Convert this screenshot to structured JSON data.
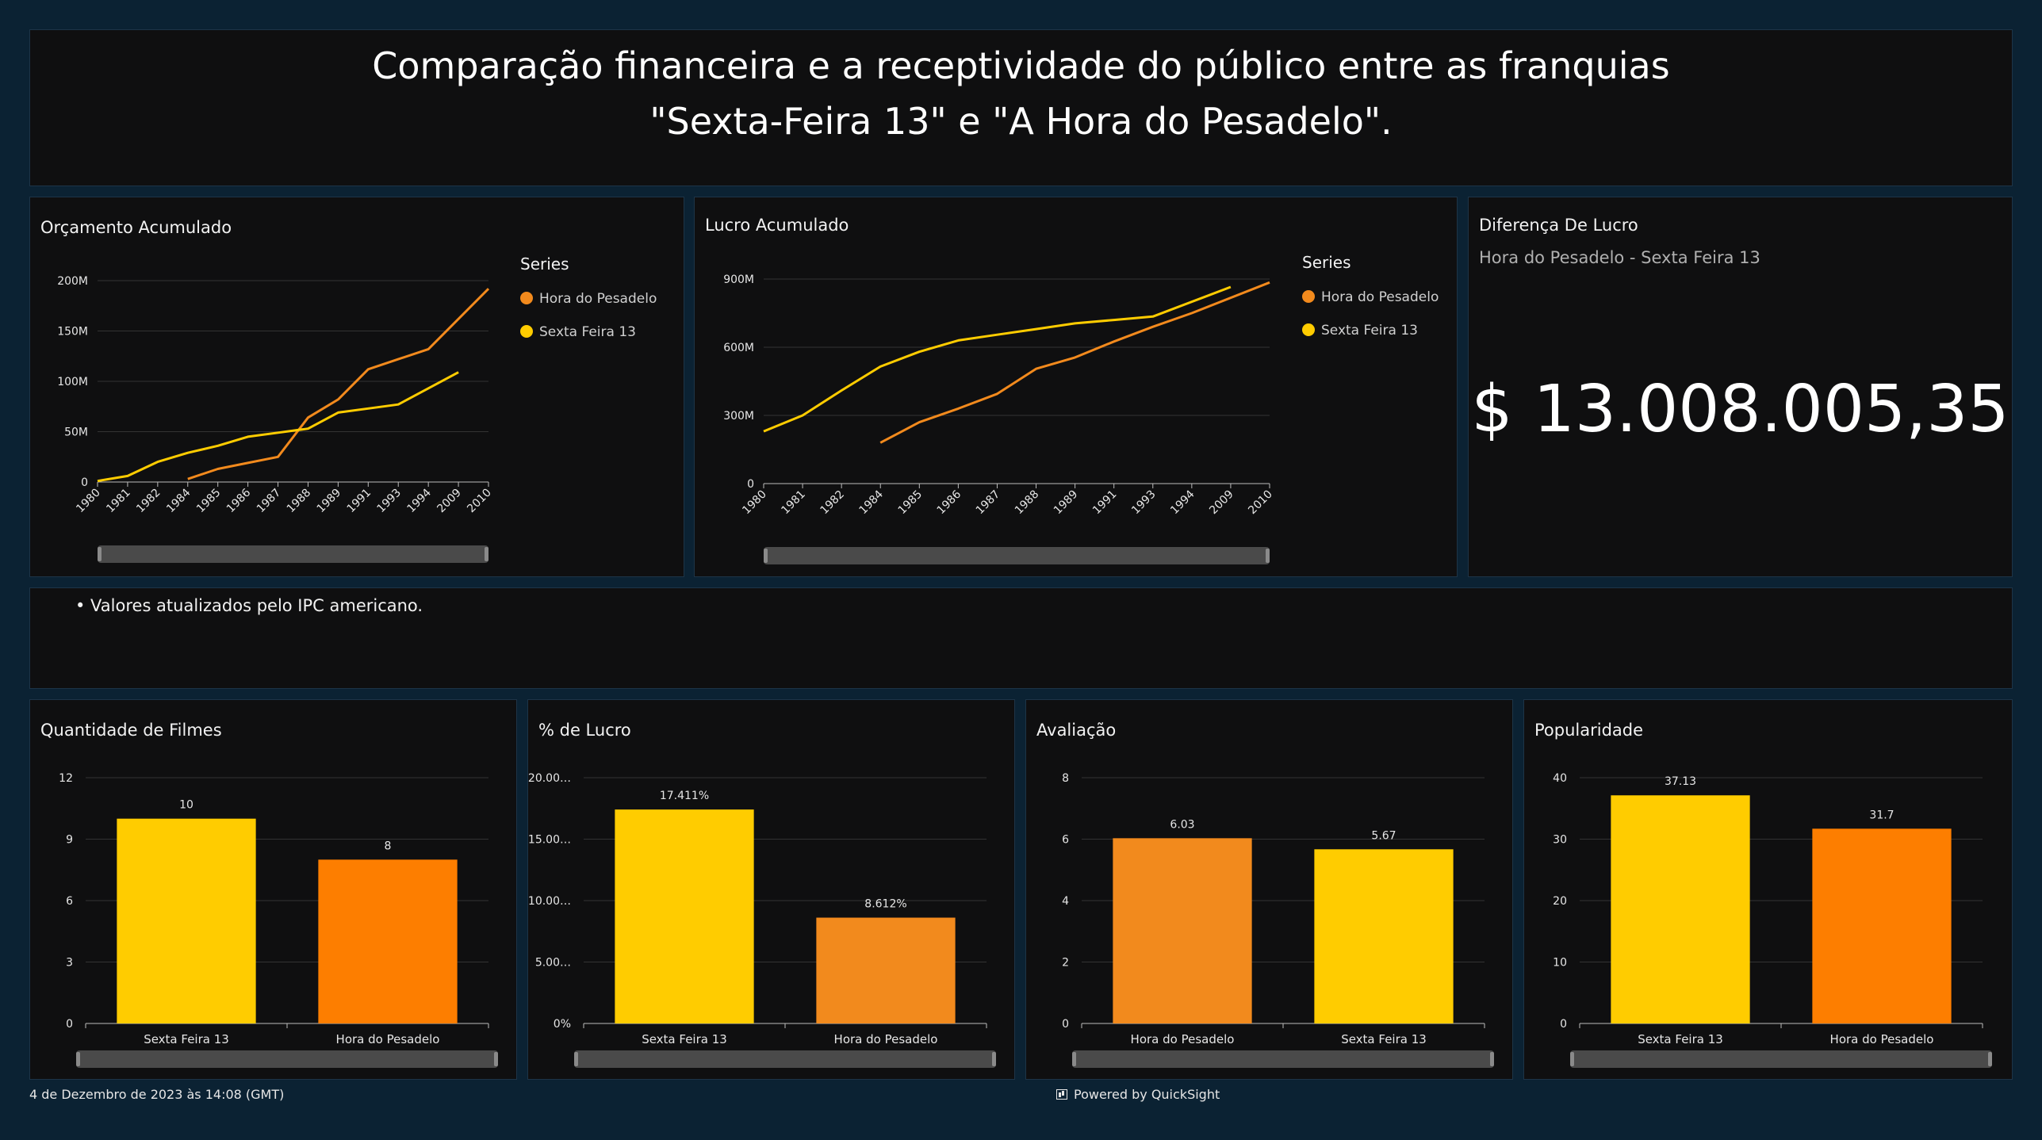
{
  "header": {
    "title_line1": "Comparação financeira e a receptividade do público entre as franquias",
    "title_line2": "\"Sexta-Feira 13\" e \"A Hora do Pesadelo\"."
  },
  "colors": {
    "hora": "#f28a1d",
    "sexta": "#ffcc00",
    "panel_bg": "#0f0f10",
    "page_bg": "#0b2233"
  },
  "kpi": {
    "title": "Diferença De Lucro",
    "subtitle": "Hora do Pesadelo - Sexta Feira 13",
    "value": "$ 13.008.005,35"
  },
  "note": {
    "text": "• Valores atualizados pelo IPC americano."
  },
  "footer": {
    "date": "4 de Dezembro de 2023 às 14:08 (GMT)",
    "powered": "Powered by QuickSight",
    "icon": "chart-icon"
  },
  "chart_data": [
    {
      "id": "orcamento",
      "type": "line",
      "title": "Orçamento Acumulado",
      "legend_title": "Series",
      "legend_position": "right",
      "x": [
        "1980",
        "1981",
        "1982",
        "1984",
        "1985",
        "1986",
        "1987",
        "1988",
        "1989",
        "1991",
        "1993",
        "1994",
        "2009",
        "2010"
      ],
      "yticks": [
        0,
        50,
        100,
        150,
        200
      ],
      "ytick_labels": [
        "0",
        "50M",
        "100M",
        "150M",
        "200M"
      ],
      "ylim": [
        0,
        200
      ],
      "series": [
        {
          "name": "Hora do Pesadelo",
          "color": "#f28a1d",
          "values": [
            null,
            null,
            null,
            3,
            13,
            19,
            25,
            64,
            82,
            112,
            122,
            132,
            null,
            192
          ]
        },
        {
          "name": "Sexta Feira 13",
          "color": "#ffcc00",
          "values": [
            1,
            6,
            20,
            29,
            36,
            45,
            49,
            53,
            69,
            73,
            77,
            null,
            109,
            null
          ]
        }
      ]
    },
    {
      "id": "lucro",
      "type": "line",
      "title": "Lucro Acumulado",
      "legend_title": "Series",
      "legend_position": "right",
      "x": [
        "1980",
        "1981",
        "1982",
        "1984",
        "1985",
        "1986",
        "1987",
        "1988",
        "1989",
        "1991",
        "1993",
        "1994",
        "2009",
        "2010"
      ],
      "yticks": [
        0,
        300,
        600,
        900
      ],
      "ytick_labels": [
        "0",
        "300M",
        "600M",
        "900M"
      ],
      "ylim": [
        0,
        900
      ],
      "series": [
        {
          "name": "Hora do Pesadelo",
          "color": "#f28a1d",
          "values": [
            null,
            null,
            null,
            180,
            270,
            330,
            395,
            505,
            555,
            625,
            690,
            750,
            null,
            885
          ]
        },
        {
          "name": "Sexta Feira 13",
          "color": "#ffcc00",
          "values": [
            230,
            300,
            410,
            515,
            580,
            630,
            655,
            680,
            705,
            720,
            735,
            null,
            865,
            null
          ]
        }
      ]
    },
    {
      "id": "quantidade",
      "type": "bar",
      "title": "Quantidade de Filmes",
      "categories": [
        "Sexta Feira 13",
        "Hora do Pesadelo"
      ],
      "values": [
        10,
        8
      ],
      "labels": [
        "10",
        "8"
      ],
      "colors": [
        "#ffcc00",
        "#fd7e00"
      ],
      "yticks": [
        0,
        3,
        6,
        9,
        12
      ],
      "ytick_labels": [
        "0",
        "3",
        "6",
        "9",
        "12"
      ],
      "ylim": [
        0,
        12
      ]
    },
    {
      "id": "pct-lucro",
      "type": "bar",
      "title": "% de Lucro",
      "categories": [
        "Sexta Feira 13",
        "Hora do Pesadelo"
      ],
      "values": [
        17.411,
        8.612
      ],
      "labels": [
        "17.411%",
        "8.612%"
      ],
      "colors": [
        "#ffcc00",
        "#f28a1d"
      ],
      "yticks": [
        0,
        5,
        10,
        15,
        20
      ],
      "ytick_labels": [
        "0%",
        "5.00…",
        "10.00…",
        "15.00…",
        "20.00…"
      ],
      "ylim": [
        0,
        20
      ]
    },
    {
      "id": "avaliacao",
      "type": "bar",
      "title": "Avaliação",
      "categories": [
        "Hora do Pesadelo",
        "Sexta Feira 13"
      ],
      "values": [
        6.03,
        5.67
      ],
      "labels": [
        "6.03",
        "5.67"
      ],
      "colors": [
        "#f28a1d",
        "#ffcc00"
      ],
      "yticks": [
        0,
        2,
        4,
        6,
        8
      ],
      "ytick_labels": [
        "0",
        "2",
        "4",
        "6",
        "8"
      ],
      "ylim": [
        0,
        8
      ]
    },
    {
      "id": "popularidade",
      "type": "bar",
      "title": "Popularidade",
      "categories": [
        "Sexta Feira 13",
        "Hora do Pesadelo"
      ],
      "values": [
        37.13,
        31.7
      ],
      "labels": [
        "37.13",
        "31.7"
      ],
      "colors": [
        "#ffcc00",
        "#fd7e00"
      ],
      "yticks": [
        0,
        10,
        20,
        30,
        40
      ],
      "ytick_labels": [
        "0",
        "10",
        "20",
        "30",
        "40"
      ],
      "ylim": [
        0,
        40
      ]
    }
  ]
}
